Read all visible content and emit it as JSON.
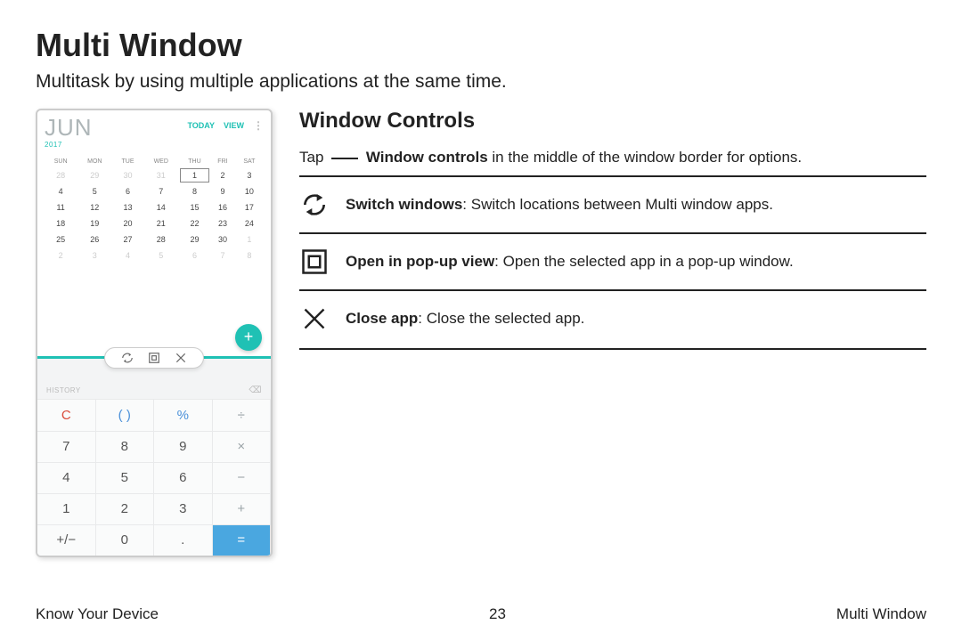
{
  "page": {
    "title": "Multi Window",
    "subtitle": "Multitask by using multiple applications at the same time."
  },
  "phone": {
    "calendar": {
      "month": "JUN",
      "year": "2017",
      "today_label": "TODAY",
      "view_label": "VIEW",
      "days": [
        "SUN",
        "MON",
        "TUE",
        "WED",
        "THU",
        "FRI",
        "SAT"
      ],
      "weeks": [
        [
          {
            "d": "28",
            "f": 1
          },
          {
            "d": "29",
            "f": 1
          },
          {
            "d": "30",
            "f": 1
          },
          {
            "d": "31",
            "f": 1
          },
          {
            "d": "1",
            "t": 1
          },
          {
            "d": "2"
          },
          {
            "d": "3"
          }
        ],
        [
          {
            "d": "4"
          },
          {
            "d": "5"
          },
          {
            "d": "6"
          },
          {
            "d": "7"
          },
          {
            "d": "8"
          },
          {
            "d": "9"
          },
          {
            "d": "10"
          }
        ],
        [
          {
            "d": "11"
          },
          {
            "d": "12"
          },
          {
            "d": "13"
          },
          {
            "d": "14"
          },
          {
            "d": "15"
          },
          {
            "d": "16"
          },
          {
            "d": "17"
          }
        ],
        [
          {
            "d": "18"
          },
          {
            "d": "19"
          },
          {
            "d": "20"
          },
          {
            "d": "21"
          },
          {
            "d": "22"
          },
          {
            "d": "23"
          },
          {
            "d": "24"
          }
        ],
        [
          {
            "d": "25"
          },
          {
            "d": "26"
          },
          {
            "d": "27"
          },
          {
            "d": "28"
          },
          {
            "d": "29"
          },
          {
            "d": "30"
          },
          {
            "d": "1",
            "f": 1
          }
        ],
        [
          {
            "d": "2",
            "f": 1
          },
          {
            "d": "3",
            "f": 1
          },
          {
            "d": "4",
            "f": 1
          },
          {
            "d": "5",
            "f": 1
          },
          {
            "d": "6",
            "f": 1
          },
          {
            "d": "7",
            "f": 1
          },
          {
            "d": "8",
            "f": 1
          }
        ]
      ]
    },
    "calculator": {
      "history_label": "HISTORY",
      "keys": [
        {
          "l": "C",
          "cls": "c"
        },
        {
          "l": "( )",
          "cls": "paren"
        },
        {
          "l": "%",
          "cls": "pct"
        },
        {
          "l": "÷",
          "cls": "op"
        },
        {
          "l": "7"
        },
        {
          "l": "8"
        },
        {
          "l": "9"
        },
        {
          "l": "×",
          "cls": "op"
        },
        {
          "l": "4"
        },
        {
          "l": "5"
        },
        {
          "l": "6"
        },
        {
          "l": "−",
          "cls": "op"
        },
        {
          "l": "1"
        },
        {
          "l": "2"
        },
        {
          "l": "3"
        },
        {
          "l": "+",
          "cls": "op"
        },
        {
          "l": "+/−"
        },
        {
          "l": "0"
        },
        {
          "l": "."
        },
        {
          "l": "=",
          "cls": "eq"
        }
      ]
    }
  },
  "explain": {
    "heading": "Window Controls",
    "tap_pre": "Tap",
    "tap_bold": "Window controls",
    "tap_post": " in the middle of the window border for options.",
    "rows": [
      {
        "bold": "Switch windows",
        "rest": ": Switch locations between Multi window apps."
      },
      {
        "bold": "Open in pop-up view",
        "rest": ": Open the selected app in a pop-up window."
      },
      {
        "bold": "Close app",
        "rest": ": Close the selected app."
      }
    ]
  },
  "footer": {
    "left": "Know Your Device",
    "center": "23",
    "right": "Multi Window"
  }
}
